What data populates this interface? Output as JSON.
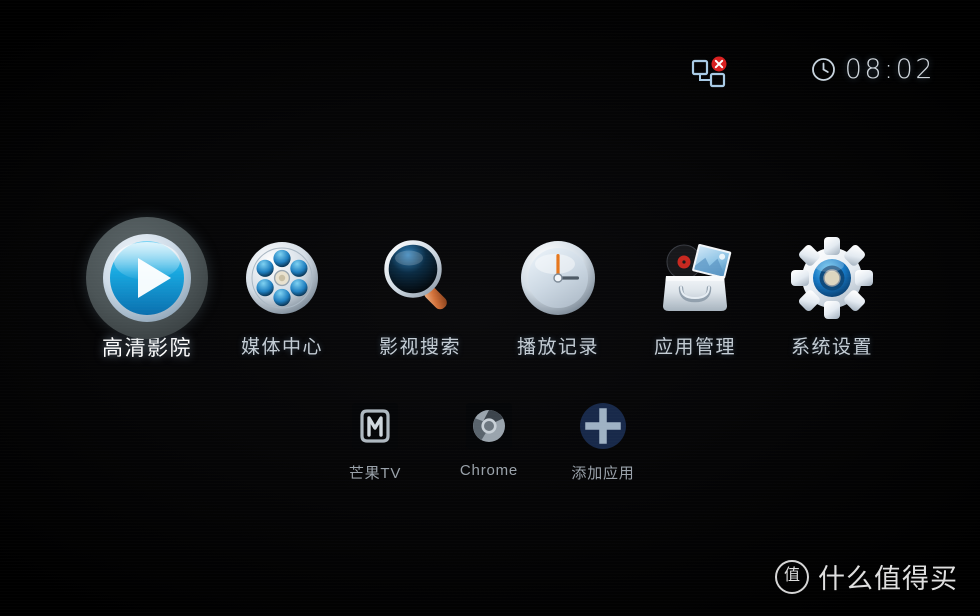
{
  "status_bar": {
    "network_icon": "network-disconnected-icon",
    "network_state": "disconnected",
    "clock_icon": "clock-icon",
    "time": "08:02"
  },
  "main_menu": {
    "selected_index": 0,
    "items": [
      {
        "label": "高清影院",
        "icon": "play-button-icon",
        "selected": true
      },
      {
        "label": "媒体中心",
        "icon": "film-reel-icon",
        "selected": false
      },
      {
        "label": "影视搜索",
        "icon": "magnifier-icon",
        "selected": false
      },
      {
        "label": "播放记录",
        "icon": "analog-clock-icon",
        "selected": false
      },
      {
        "label": "应用管理",
        "icon": "app-basket-icon",
        "selected": false
      },
      {
        "label": "系统设置",
        "icon": "gear-icon",
        "selected": false
      }
    ]
  },
  "app_shortcuts": {
    "items": [
      {
        "label": "芒果TV",
        "icon": "mango-tv-icon"
      },
      {
        "label": "Chrome",
        "icon": "chrome-icon"
      },
      {
        "label": "添加应用",
        "icon": "plus-circle-icon"
      }
    ]
  },
  "watermark": {
    "badge": "值",
    "text": "什么值得买"
  },
  "colors": {
    "background": "#000000",
    "selection_ring": "#4b5456",
    "accent_blue": "#1f9ed8",
    "error_red": "#e02020",
    "add_app_circle": "#1b2a4a",
    "label_text": "#c3ccd4"
  }
}
